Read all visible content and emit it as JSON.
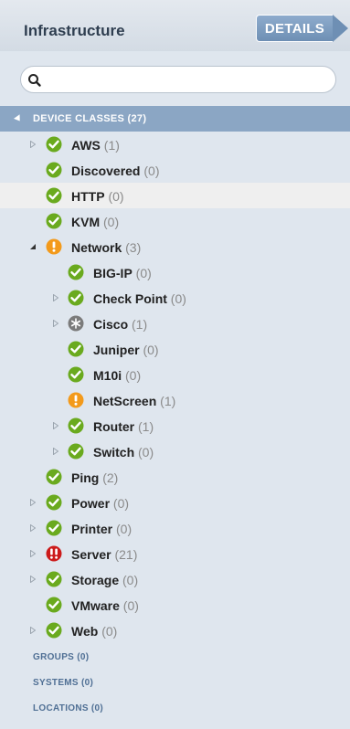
{
  "panel": {
    "title": "Infrastructure",
    "details_label": "DETAILS"
  },
  "search": {
    "placeholder": ""
  },
  "tree": {
    "section_label": "DEVICE CLASSES",
    "section_count": "(27)",
    "items": [
      {
        "label": "AWS",
        "count": "(1)",
        "status": "ok",
        "depth": 1,
        "toggle": "collapsed",
        "selected": false
      },
      {
        "label": "Discovered",
        "count": "(0)",
        "status": "ok",
        "depth": 1,
        "toggle": "none",
        "selected": false
      },
      {
        "label": "HTTP",
        "count": "(0)",
        "status": "ok",
        "depth": 1,
        "toggle": "none",
        "selected": true
      },
      {
        "label": "KVM",
        "count": "(0)",
        "status": "ok",
        "depth": 1,
        "toggle": "none",
        "selected": false
      },
      {
        "label": "Network",
        "count": "(3)",
        "status": "warning",
        "depth": 1,
        "toggle": "expanded",
        "selected": false
      },
      {
        "label": "BIG-IP",
        "count": "(0)",
        "status": "ok",
        "depth": 2,
        "toggle": "none",
        "selected": false
      },
      {
        "label": "Check Point",
        "count": "(0)",
        "status": "ok",
        "depth": 2,
        "toggle": "collapsed",
        "selected": false
      },
      {
        "label": "Cisco",
        "count": "(1)",
        "status": "unknown",
        "depth": 2,
        "toggle": "collapsed",
        "selected": false
      },
      {
        "label": "Juniper",
        "count": "(0)",
        "status": "ok",
        "depth": 2,
        "toggle": "none",
        "selected": false
      },
      {
        "label": "M10i",
        "count": "(0)",
        "status": "ok",
        "depth": 2,
        "toggle": "none",
        "selected": false
      },
      {
        "label": "NetScreen",
        "count": "(1)",
        "status": "warning",
        "depth": 2,
        "toggle": "none",
        "selected": false
      },
      {
        "label": "Router",
        "count": "(1)",
        "status": "ok",
        "depth": 2,
        "toggle": "collapsed",
        "selected": false
      },
      {
        "label": "Switch",
        "count": "(0)",
        "status": "ok",
        "depth": 2,
        "toggle": "collapsed",
        "selected": false
      },
      {
        "label": "Ping",
        "count": "(2)",
        "status": "ok",
        "depth": 1,
        "toggle": "none",
        "selected": false
      },
      {
        "label": "Power",
        "count": "(0)",
        "status": "ok",
        "depth": 1,
        "toggle": "collapsed",
        "selected": false
      },
      {
        "label": "Printer",
        "count": "(0)",
        "status": "ok",
        "depth": 1,
        "toggle": "collapsed",
        "selected": false
      },
      {
        "label": "Server",
        "count": "(21)",
        "status": "critical",
        "depth": 1,
        "toggle": "collapsed",
        "selected": false
      },
      {
        "label": "Storage",
        "count": "(0)",
        "status": "ok",
        "depth": 1,
        "toggle": "collapsed",
        "selected": false
      },
      {
        "label": "VMware",
        "count": "(0)",
        "status": "ok",
        "depth": 1,
        "toggle": "none",
        "selected": false
      },
      {
        "label": "Web",
        "count": "(0)",
        "status": "ok",
        "depth": 1,
        "toggle": "collapsed",
        "selected": false
      }
    ]
  },
  "footer_links": [
    {
      "label": "GROUPS",
      "count": "(0)"
    },
    {
      "label": "SYSTEMS",
      "count": "(0)"
    },
    {
      "label": "LOCATIONS",
      "count": "(0)"
    }
  ],
  "colors": {
    "ok": "#6aaa1e",
    "warning": "#f39a1b",
    "critical": "#cc1b1b",
    "unknown": "#7b7b7b",
    "section_bg": "#8ba6c4",
    "panel_bg": "#dfe6ee"
  },
  "icons": {
    "ok": "check-circle-icon",
    "warning": "exclamation-circle-icon",
    "critical": "double-exclamation-circle-icon",
    "unknown": "snowflake-circle-icon"
  }
}
